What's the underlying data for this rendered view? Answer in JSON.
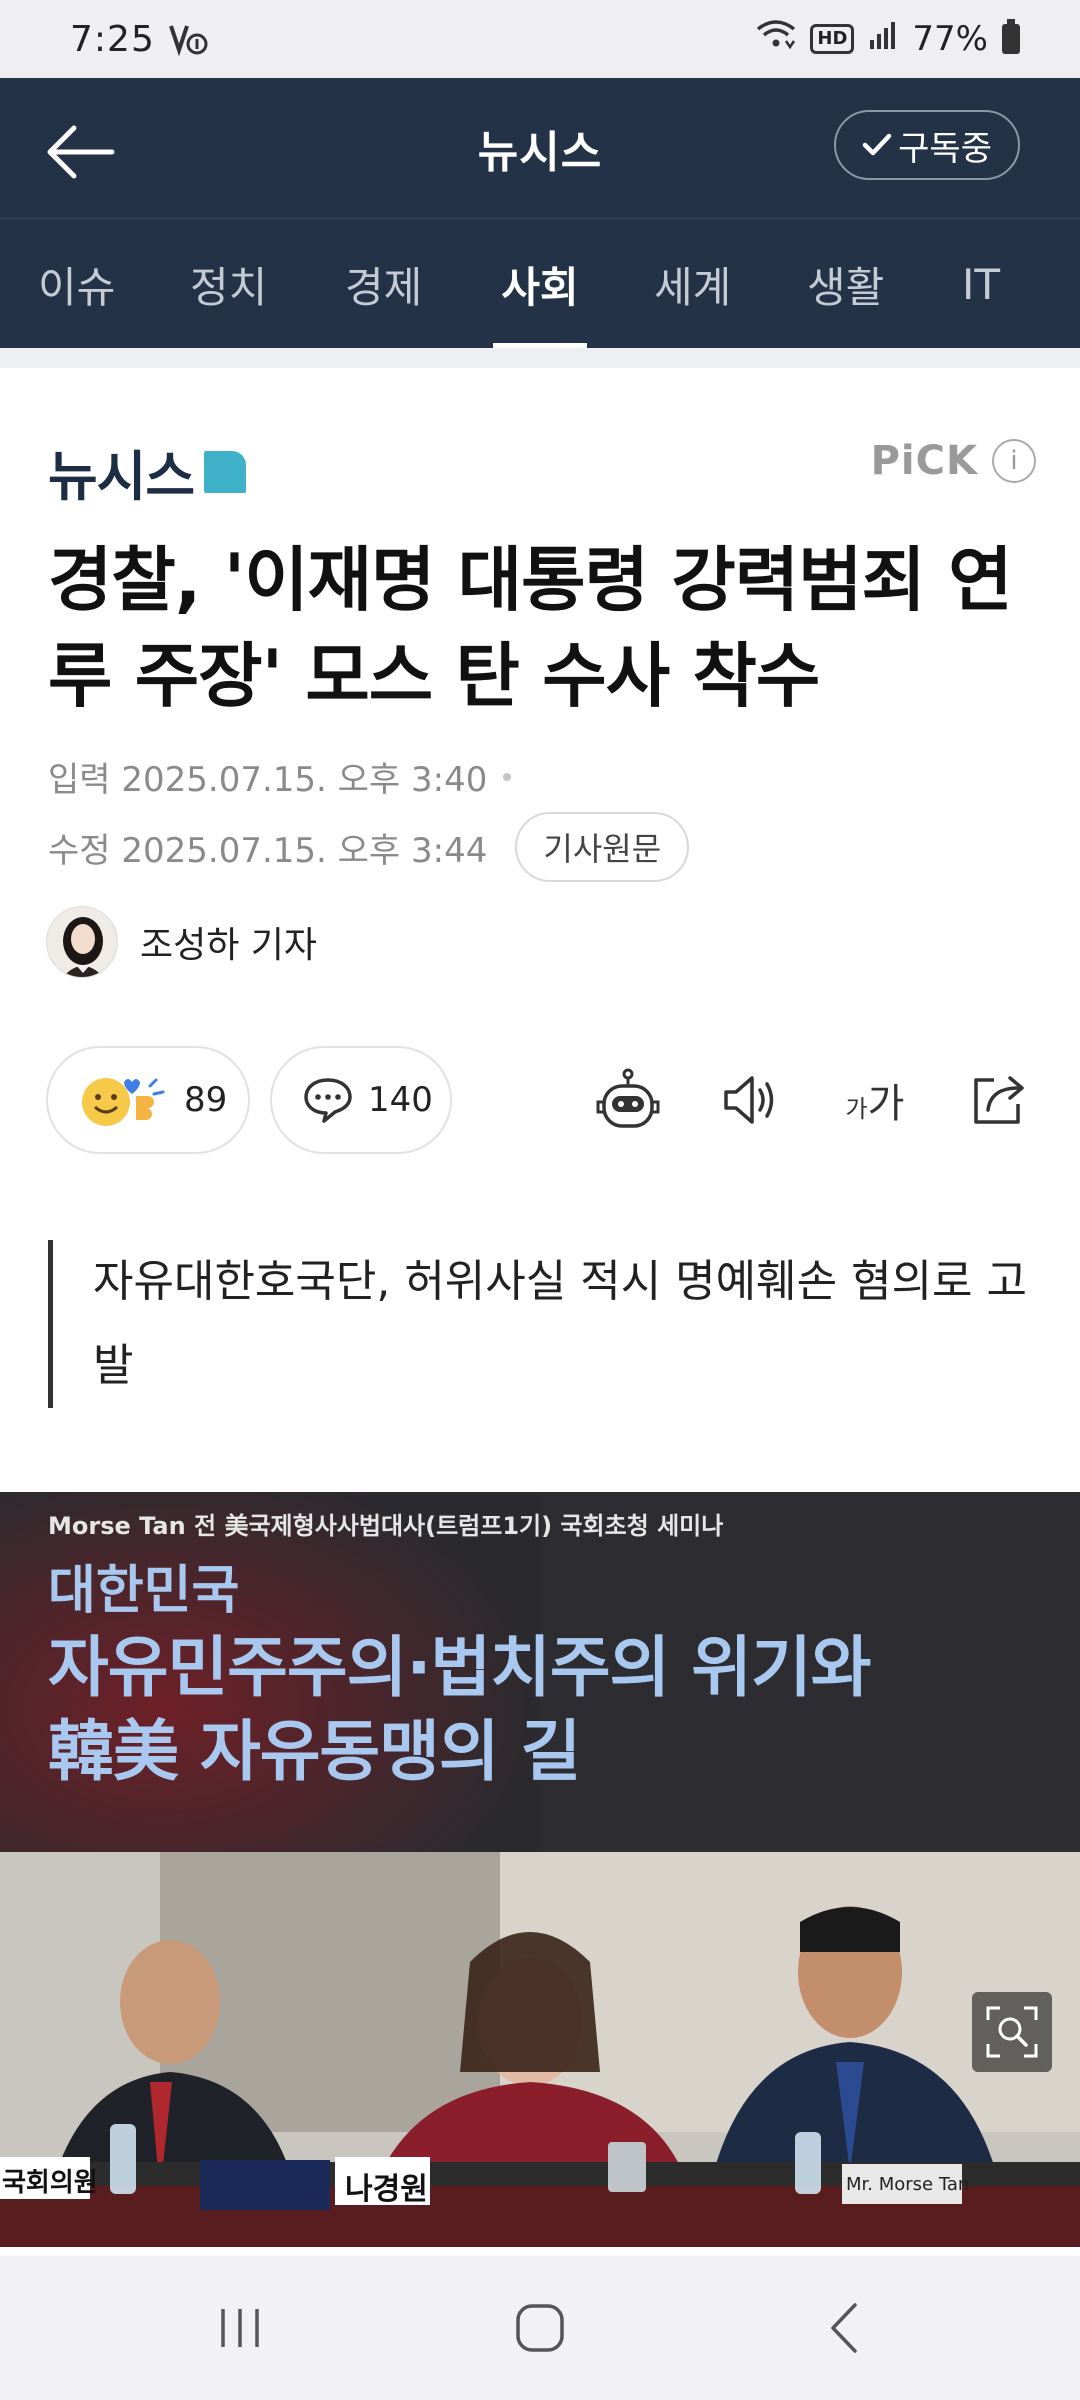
{
  "status_bar": {
    "time": "7:25",
    "battery": "77%",
    "left_icons": [
      "volte-icon"
    ],
    "right_icons": [
      "wifi-icon",
      "hd-icon",
      "signal-icon",
      "battery-icon"
    ],
    "hd_label": "HD"
  },
  "header": {
    "title": "뉴시스",
    "subscribe_label": "구독중"
  },
  "tabs": [
    {
      "label": "이슈"
    },
    {
      "label": "정치"
    },
    {
      "label": "경제"
    },
    {
      "label": "사회",
      "active": true
    },
    {
      "label": "세계"
    },
    {
      "label": "생활"
    },
    {
      "label": "IT"
    }
  ],
  "article": {
    "publisher": "뉴시스",
    "pick_label": "PiCK",
    "pick_info": "i",
    "title": "경찰, '이재명 대통령 강력범죄 연루 주장' 모스 탄 수사 착수",
    "published": "입력 2025.07.15. 오후 3:40",
    "modified": "수정 2025.07.15. 오후 3:44",
    "original_link": "기사원문",
    "author": "조성하 기자",
    "reaction_count": "89",
    "comment_count": "140",
    "font_size_label": "가가",
    "subtitle": "자유대한호국단, 허위사실 적시 명예훼손 혐의로 고발"
  },
  "photo": {
    "banner_small": "Morse Tan 전 美국제형사사법대사(트럼프1기) 국회초청 세미나",
    "banner_line1": "대한민국",
    "banner_line2": "자유민주주의·법치주의 위기와",
    "banner_line3": "韓美 자유동맹의 길",
    "nameplate_left": "국회의원",
    "nameplate_center": "나경원",
    "nameplate_right": "Mr. Morse Tan"
  },
  "colors": {
    "header_bg": "#233246",
    "accent_logo": "#3fb1c8",
    "banner_text": "#a9c8f0"
  }
}
